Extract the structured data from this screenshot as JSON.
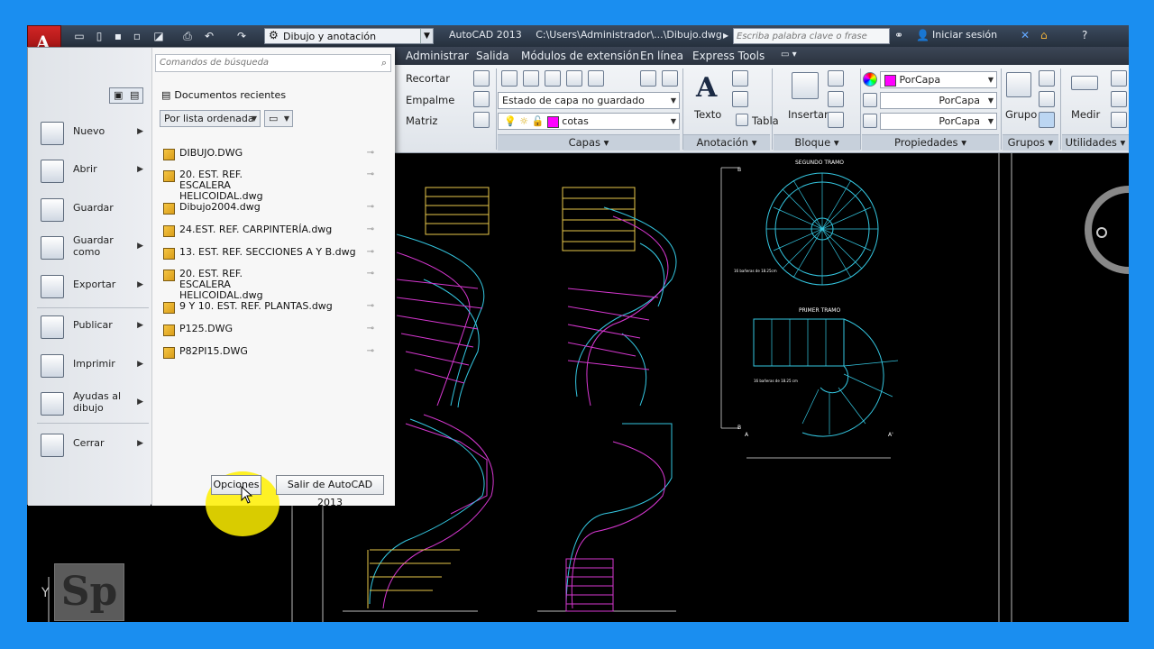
{
  "titlebar": {
    "workspace": "Dibujo y anotación",
    "app_name": "AutoCAD 2013",
    "file_path": "C:\\Users\\Administrador\\...\\Dibujo.dwg",
    "search_placeholder": "Escriba palabra clave o frase",
    "signin": "Iniciar sesión"
  },
  "tabs": [
    "Administrar",
    "Salida",
    "Módulos de extensión",
    "En línea",
    "Express Tools"
  ],
  "ribbon": {
    "modify": {
      "recortar": "Recortar",
      "empalme": "Empalme",
      "matriz": "Matriz"
    },
    "layers": {
      "layer_state": "Estado de capa no guardado",
      "layer_current": "cotas",
      "panel": "Capas"
    },
    "annotation": {
      "texto": "Texto",
      "tabla": "Tabla",
      "panel": "Anotación"
    },
    "block": {
      "insertar": "Insertar",
      "panel": "Bloque"
    },
    "properties": {
      "color": "PorCapa",
      "linetype": "PorCapa",
      "lineweight": "PorCapa",
      "panel": "Propiedades"
    },
    "groups": {
      "grupo": "Grupo",
      "panel": "Grupos"
    },
    "utilities": {
      "medir": "Medir",
      "panel": "Utilidades"
    }
  },
  "drawing": {
    "plan_title_upper": "SEGUNDO TRAMO",
    "plan_title_lower": "PRIMER TRAMO",
    "note_upper": "16 bañeras de 18.25cm",
    "note_lower": "16 bañeras de 18.25 cm",
    "section_markers": [
      "B",
      "B",
      "A",
      "A'"
    ],
    "ucs_y": "Y",
    "logo": "Sp"
  },
  "app_menu": {
    "search_placeholder": "Comandos de búsqueda",
    "recent_title": "Documentos recientes",
    "sort": "Por lista ordenada",
    "items": [
      {
        "label": "Nuevo"
      },
      {
        "label": "Abrir"
      },
      {
        "label": "Guardar"
      },
      {
        "label": "Guardar como"
      },
      {
        "label": "Exportar"
      },
      {
        "label": "Publicar"
      },
      {
        "label": "Imprimir"
      },
      {
        "label": "Ayudas al dibujo"
      },
      {
        "label": "Cerrar"
      }
    ],
    "recent_files": [
      "DIBUJO.DWG",
      "20. EST. REF. ESCALERA HELICOIDAL.dwg",
      "Dibujo2004.dwg",
      "24.EST. REF. CARPINTERÍA.dwg",
      "13. EST. REF. SECCIONES A Y B.dwg",
      "20. EST. REF. ESCALERA HELICOIDAL.dwg",
      "9 Y 10. EST. REF. PLANTAS.dwg",
      "P125.DWG",
      "P82PI15.DWG"
    ],
    "options_button": "Opciones",
    "exit_button": "Salir de AutoCAD 2013"
  },
  "colors": {
    "accent_frame": "#1a8ef0",
    "layer_color": "#ff00ff",
    "cad_cyan": "#34c6e0",
    "cad_magenta": "#d637d0",
    "cad_yellow": "#e8c94a"
  }
}
